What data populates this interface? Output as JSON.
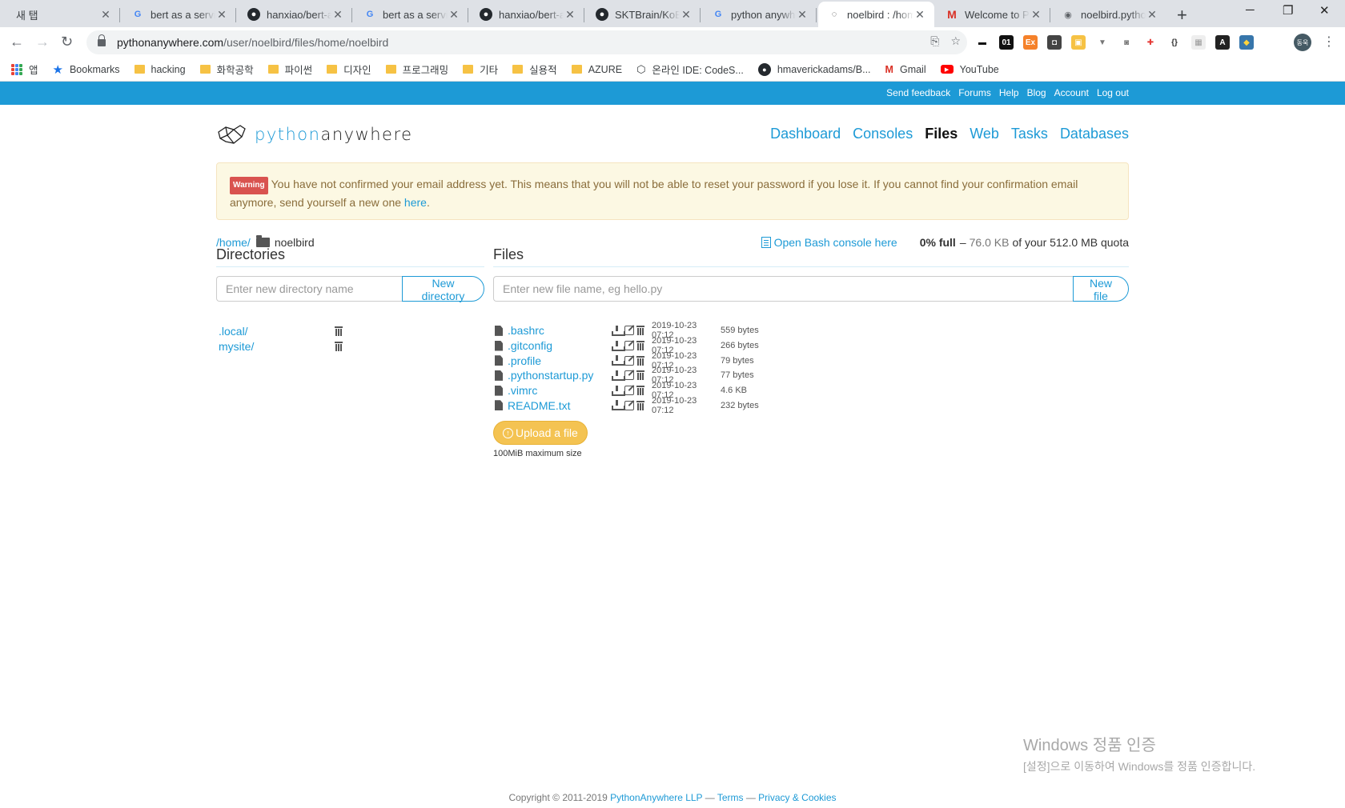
{
  "browser": {
    "tabs": [
      {
        "title": "새 탭",
        "favicon": "blank",
        "active": false
      },
      {
        "title": "bert as a service",
        "favicon": "google-icon",
        "active": false
      },
      {
        "title": "hanxiao/bert-as-service",
        "favicon": "github-icon",
        "active": false
      },
      {
        "title": "bert as a service",
        "favicon": "google-icon",
        "active": false
      },
      {
        "title": "hanxiao/bert-as-service",
        "favicon": "github-icon",
        "active": false
      },
      {
        "title": "SKTBrain/KoBERT",
        "favicon": "github-icon",
        "active": false
      },
      {
        "title": "python anywhere",
        "favicon": "google-icon",
        "active": false
      },
      {
        "title": "noelbird : /home/noelbird",
        "favicon": "pythonanywhere-icon",
        "active": true
      },
      {
        "title": "Welcome to PythonAnywhere",
        "favicon": "gmail-icon",
        "active": false
      },
      {
        "title": "noelbird.pythonanywhere.com",
        "favicon": "globe-icon",
        "active": false
      }
    ],
    "url_host": "pythonanywhere.com",
    "url_path": "/user/noelbird/files/home/noelbird",
    "profile_initials": "동욱",
    "bookmarks": [
      {
        "label": "앱",
        "icon": "apps-icon"
      },
      {
        "label": "Bookmarks",
        "icon": "star-icon"
      },
      {
        "label": "hacking",
        "icon": "folder-icon"
      },
      {
        "label": "화학공학",
        "icon": "folder-icon"
      },
      {
        "label": "파이썬",
        "icon": "folder-icon"
      },
      {
        "label": "디자인",
        "icon": "folder-icon"
      },
      {
        "label": "프로그래밍",
        "icon": "folder-icon"
      },
      {
        "label": "기타",
        "icon": "folder-icon"
      },
      {
        "label": "실용적",
        "icon": "folder-icon"
      },
      {
        "label": "AZURE",
        "icon": "folder-icon"
      },
      {
        "label": "온라인 IDE: CodeS...",
        "icon": "cube-icon"
      },
      {
        "label": "hmaverickadams/B...",
        "icon": "github-icon"
      },
      {
        "label": "Gmail",
        "icon": "gmail-icon"
      },
      {
        "label": "YouTube",
        "icon": "youtube-icon"
      }
    ]
  },
  "topstrip": {
    "links": [
      "Send feedback",
      "Forums",
      "Help",
      "Blog",
      "Account",
      "Log out"
    ]
  },
  "brand": {
    "part1": "python",
    "part2": "anywhere"
  },
  "nav": {
    "items": [
      "Dashboard",
      "Consoles",
      "Files",
      "Web",
      "Tasks",
      "Databases"
    ],
    "current": "Files"
  },
  "alert": {
    "badge": "Warning",
    "text": "You have not confirmed your email address yet. This means that you will not be able to reset your password if you lose it. If you cannot find your confirmation email anymore, send yourself a new one ",
    "link": "here",
    "end": "."
  },
  "breadcrumb": {
    "root": "/home/",
    "current": "noelbird"
  },
  "quota": {
    "console_link": "Open Bash console here",
    "percent": "0% full",
    "dash": " – ",
    "used": "76.0 KB",
    "rest": "of your 512.0 MB quota"
  },
  "directories": {
    "heading": "Directories",
    "placeholder": "Enter new directory name",
    "button": "New directory",
    "items": [
      ".local/",
      "mysite/"
    ]
  },
  "files": {
    "heading": "Files",
    "placeholder": "Enter new file name, eg hello.py",
    "button": "New file",
    "items": [
      {
        "name": ".bashrc",
        "date": "2019-10-23 07:12",
        "size": "559 bytes"
      },
      {
        "name": ".gitconfig",
        "date": "2019-10-23 07:12",
        "size": "266 bytes"
      },
      {
        "name": ".profile",
        "date": "2019-10-23 07:12",
        "size": "79 bytes"
      },
      {
        "name": ".pythonstartup.py",
        "date": "2019-10-23 07:12",
        "size": "77 bytes"
      },
      {
        "name": ".vimrc",
        "date": "2019-10-23 07:12",
        "size": "4.6 KB"
      },
      {
        "name": "README.txt",
        "date": "2019-10-23 07:12",
        "size": "232 bytes"
      }
    ],
    "upload_button": "Upload a file",
    "upload_note": "100MiB maximum size"
  },
  "watermark": {
    "line1": "Windows 정품 인증",
    "line2": "[설정]으로 이동하여 Windows를 정품 인증합니다."
  },
  "footer": {
    "copyright": "Copyright © 2011-2019 ",
    "company": "PythonAnywhere LLP",
    "sep": " — ",
    "terms": "Terms",
    "privacy": "Privacy & Cookies"
  }
}
